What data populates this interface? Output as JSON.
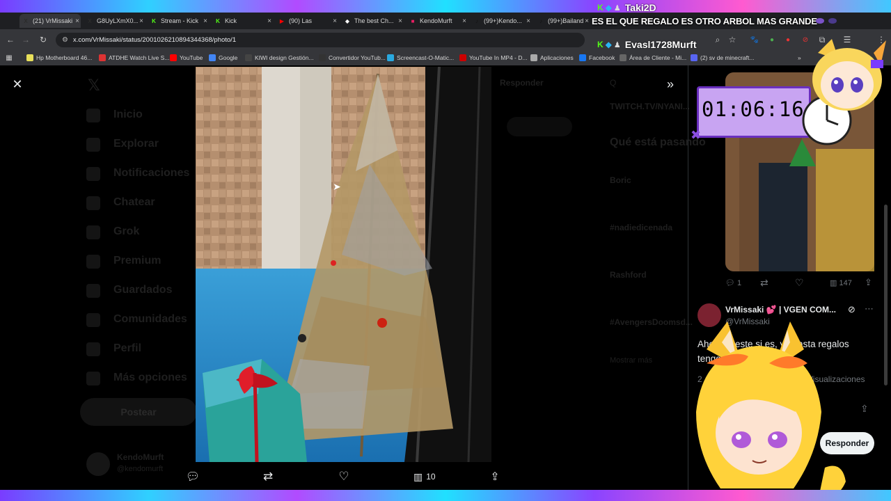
{
  "tabs": [
    {
      "label": "(21) VrMissaki",
      "color": "#2b2b2b",
      "glyph": "X",
      "active": true
    },
    {
      "label": "G8UyLXmX0...",
      "color": "#2b2b2b",
      "glyph": "X"
    },
    {
      "label": "Stream - Kick",
      "color": "#53fc18",
      "glyph": "K"
    },
    {
      "label": "Kick",
      "color": "#53fc18",
      "glyph": "K"
    },
    {
      "label": "(90) Las",
      "color": "#ff0000",
      "glyph": "▶"
    },
    {
      "label": "The best Ch...",
      "color": "#fff",
      "glyph": "◆"
    },
    {
      "label": "KendoMurft",
      "color": "#e91e63",
      "glyph": "■"
    },
    {
      "label": "(99+)Kendo...",
      "color": "#111",
      "glyph": "♪"
    },
    {
      "label": "(99+)Bailand...",
      "color": "#111",
      "glyph": "♪"
    }
  ],
  "url": "x.com/VrMissaki/status/2001026210894344368/photo/1",
  "bookmarks": [
    {
      "label": "Hp Motherboard 46...",
      "color": "#e8e05a"
    },
    {
      "label": "ATDHE Watch Live S...",
      "color": "#d33"
    },
    {
      "label": "YouTube",
      "color": "#f00"
    },
    {
      "label": "Google",
      "color": "#4285f4"
    },
    {
      "label": "KIWI design Gestión...",
      "color": "#444"
    },
    {
      "label": "Convertidor YouTub...",
      "color": "#333"
    },
    {
      "label": "Screencast-O-Matic...",
      "color": "#29a9e0"
    },
    {
      "label": "YouTube In MP4 - D...",
      "color": "#c00"
    },
    {
      "label": "Aplicaciones",
      "color": "#aaa"
    },
    {
      "label": "Facebook",
      "color": "#1877f2"
    },
    {
      "label": "Área de Cliente - Mi...",
      "color": "#666"
    },
    {
      "label": "(2) sv de minecraft...",
      "color": "#5865f2"
    }
  ],
  "bookmark_overflow": "»",
  "stream_overlay": {
    "alert_text": "ES EL QUE REGALO ES OTRO ARBOL MAS GRANDE",
    "chat_user_1": "Taki2D",
    "chat_user_2": "Evasl1728Murft",
    "timer": "01:06:16"
  },
  "sidebar_dim": [
    "Inicio",
    "Explorar",
    "Notificaciones",
    "Chatear",
    "Grok",
    "Premium",
    "Guardados",
    "Comunidades",
    "Perfil",
    "Más opciones"
  ],
  "post_button": "Postear",
  "profile_dim": {
    "name": "KendoMurft",
    "handle": "@kendomurft"
  },
  "center_dim": {
    "reply": "Responder"
  },
  "trends_dim": {
    "header": "Qué está pasando",
    "twitch_link": "TWITCH.TV/NYANI...",
    "items": [
      "Boric",
      "#nadiedicenada",
      "Rashford",
      "#AvengersDoomsd..."
    ],
    "more": "Mostrar más"
  },
  "photo_actions": {
    "views": "10"
  },
  "right_tweet": {
    "replies": "1",
    "views": "147",
    "author_name": "VrMissaki 💕 | VGEN COM...",
    "author_handle": "@VrMissaki",
    "text": "Ahora sí este si es, ya hasta regalos tengo 💕🎁",
    "stats_prefix": "2",
    "views_label": "0 Visualizaciones",
    "reply_button": "Responder"
  }
}
